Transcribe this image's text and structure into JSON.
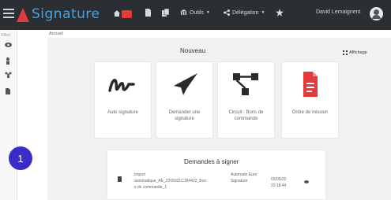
{
  "app": {
    "title": "Signature"
  },
  "topbar": {
    "menu_icon": "hamburger-icon",
    "nav": [
      {
        "icon": "home-icon",
        "label": ""
      },
      {
        "icon": "file-icon",
        "label": ""
      },
      {
        "icon": "files-icon",
        "label": ""
      },
      {
        "icon": "bank-icon",
        "label": "Outils"
      },
      {
        "icon": "share-icon",
        "label": "Délégation"
      },
      {
        "icon": "star-icon",
        "label": ""
      }
    ],
    "user_name": "David Lemaignent",
    "colors": {
      "bar": "#2b2f33",
      "badge": "#e23b3b",
      "logo_text": "#4aa3df"
    }
  },
  "sidebar": {
    "label": "Filtre",
    "icons": [
      "eye-icon",
      "person-icon",
      "group-icon",
      "document-icon"
    ]
  },
  "breadcrumb": "Accueil",
  "main": {
    "section_title": "Nouveau",
    "display_label": "Affichage",
    "cards": [
      {
        "label": "Auto signature",
        "icon": "signature-icon"
      },
      {
        "label": "Demander une signature",
        "icon": "send-icon"
      },
      {
        "label": "Circuit : Bons de commande",
        "icon": "workflow-icon"
      },
      {
        "label": "Ordre de mission",
        "icon": "pdf-icon"
      }
    ]
  },
  "requests": {
    "title": "Demandes à signer",
    "rows": [
      {
        "document": "Import automatique_AE_2205031C184422_Bon s de commande_1",
        "type": "Automate Euro Signature",
        "date": "03/05/20",
        "time": "22:18:44"
      }
    ]
  },
  "overlay": {
    "step_number": "1",
    "color": "#3a2cc9"
  }
}
